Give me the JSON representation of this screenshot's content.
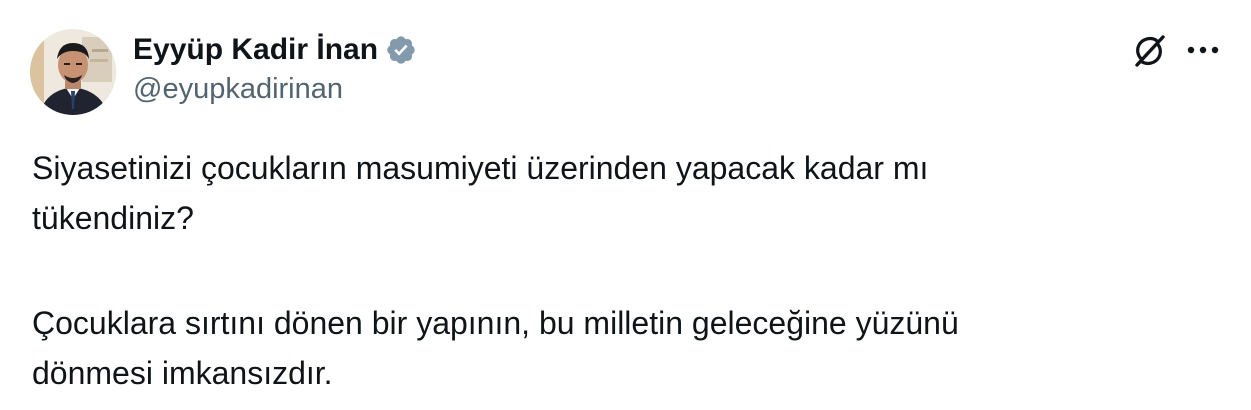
{
  "author": {
    "display_name": "Eyyüp Kadir İnan",
    "handle": "@eyupkadirinan",
    "verified": true
  },
  "icons": {
    "verified": "verified-badge-icon",
    "grok": "grok-icon",
    "more": "more-options-icon"
  },
  "colors": {
    "text": "#0f1419",
    "secondary": "#536471",
    "verified_badge": "#829aab",
    "background": "#ffffff"
  },
  "tweet": {
    "paragraph1": {
      "line1": "Siyasetinizi çocukların masumiyeti üzerinden yapacak kadar mı",
      "line2": "tükendiniz?"
    },
    "paragraph2": {
      "line1": "Çocuklara sırtını dönen bir yapının, bu milletin geleceğine yüzünü",
      "line2": "dönmesi imkansızdır."
    }
  }
}
